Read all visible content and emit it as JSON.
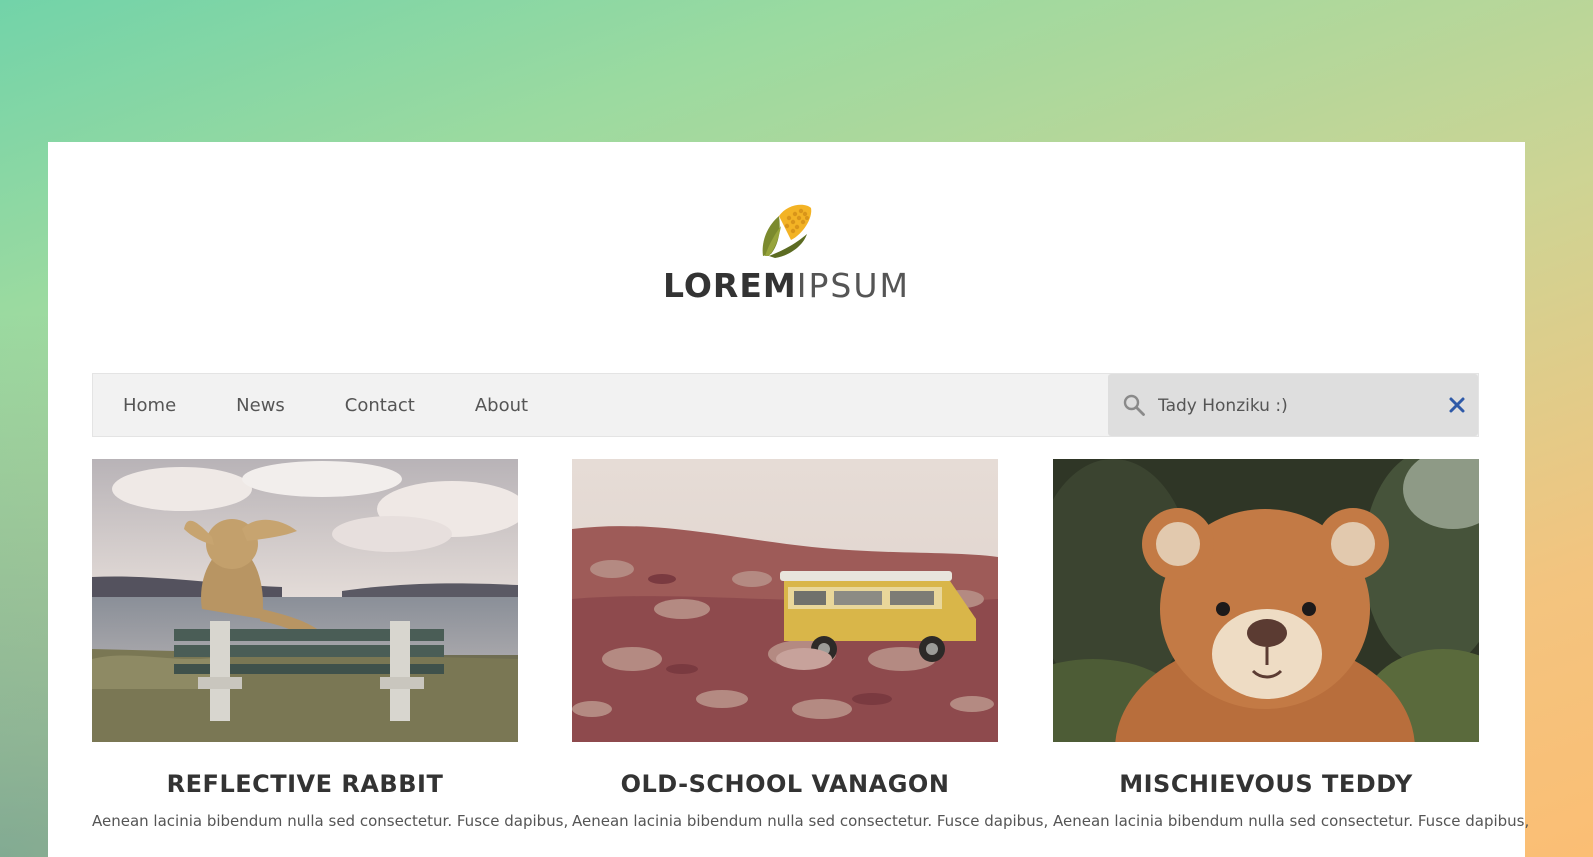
{
  "brand": {
    "name_bold": "LOREM",
    "name_light": "IPSUM",
    "logo_icon": "corn-icon"
  },
  "nav": {
    "items": [
      {
        "label": "Home"
      },
      {
        "label": "News"
      },
      {
        "label": "Contact"
      },
      {
        "label": "About"
      }
    ]
  },
  "search": {
    "value": "Tady Honziku :)",
    "search_icon": "search-icon",
    "clear_icon": "close-icon"
  },
  "posts": [
    {
      "title": "REFLECTIVE RABBIT",
      "excerpt": "Aenean lacinia bibendum nulla sed consectetur. Fusce dapibus,",
      "image": "rabbit-on-bench-photo"
    },
    {
      "title": "OLD-SCHOOL VANAGON",
      "excerpt": "Aenean lacinia bibendum nulla sed consectetur. Fusce dapibus,",
      "image": "yellow-van-photo"
    },
    {
      "title": "MISCHIEVOUS TEDDY",
      "excerpt": "Aenean lacinia bibendum nulla sed consectetur. Fusce dapibus,",
      "image": "teddy-bear-photo"
    }
  ],
  "colors": {
    "accent_clear": "#2f5aa8",
    "text_dark": "#333333"
  }
}
